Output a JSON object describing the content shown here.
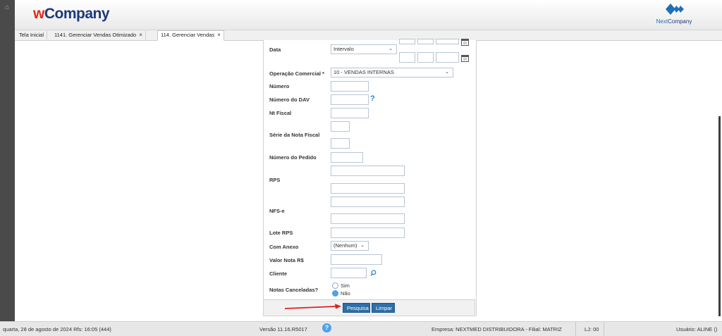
{
  "header": {
    "logo_w": "w",
    "logo_rest": "Company",
    "brand_prefix": "Next",
    "brand_suffix": "Company"
  },
  "tabs": [
    {
      "label": "Tela Inicial"
    },
    {
      "label": "1141. Gerenciar Vendas Otimizado",
      "close": "×"
    },
    {
      "label": "114. Gerenciar Vendas",
      "close": "×"
    }
  ],
  "form": {
    "data_label": "Data",
    "data_select": "Intervalo",
    "operacao_label": "Operação Comercial *",
    "operacao_select": "10 - VENDAS INTERNAS",
    "numero_label": "Número",
    "numero_dav_label": "Número do DAV",
    "nt_fiscal_label": "Nt Fiscal",
    "serie_label": "Série da Nota Fiscal",
    "pedido_label": "Número do Pedido",
    "rps_label": "RPS",
    "nfse_label": "NFS-e",
    "lote_rps_label": "Lote RPS",
    "anexo_label": "Com Anexo",
    "anexo_select": "(Nenhum)",
    "valor_label": "Valor Nota R$",
    "cliente_label": "Cliente",
    "canceladas_label": "Notas Canceladas?",
    "opt_sim": "Sim",
    "opt_nao": "Não",
    "selected_option": "Não"
  },
  "buttons": {
    "pesquisa": "Pesquisa",
    "limpar": "Limpar"
  },
  "status": {
    "date": "quarta, 28 de agosto de 2024  Rfs: 16:05 (444)",
    "version": "Versão 11.16.R5017",
    "empresa": "Empresa: NEXTMED DISTRIBUIDORA - Filial: MATRIZ",
    "lj": "LJ: 00",
    "usuario": "Usuário: ALINE ()"
  },
  "colors": {
    "accent": "#2d6fa8",
    "logo_red": "#e0291b",
    "logo_blue": "#1b3a78",
    "annotation_arrow": "#e02020"
  }
}
